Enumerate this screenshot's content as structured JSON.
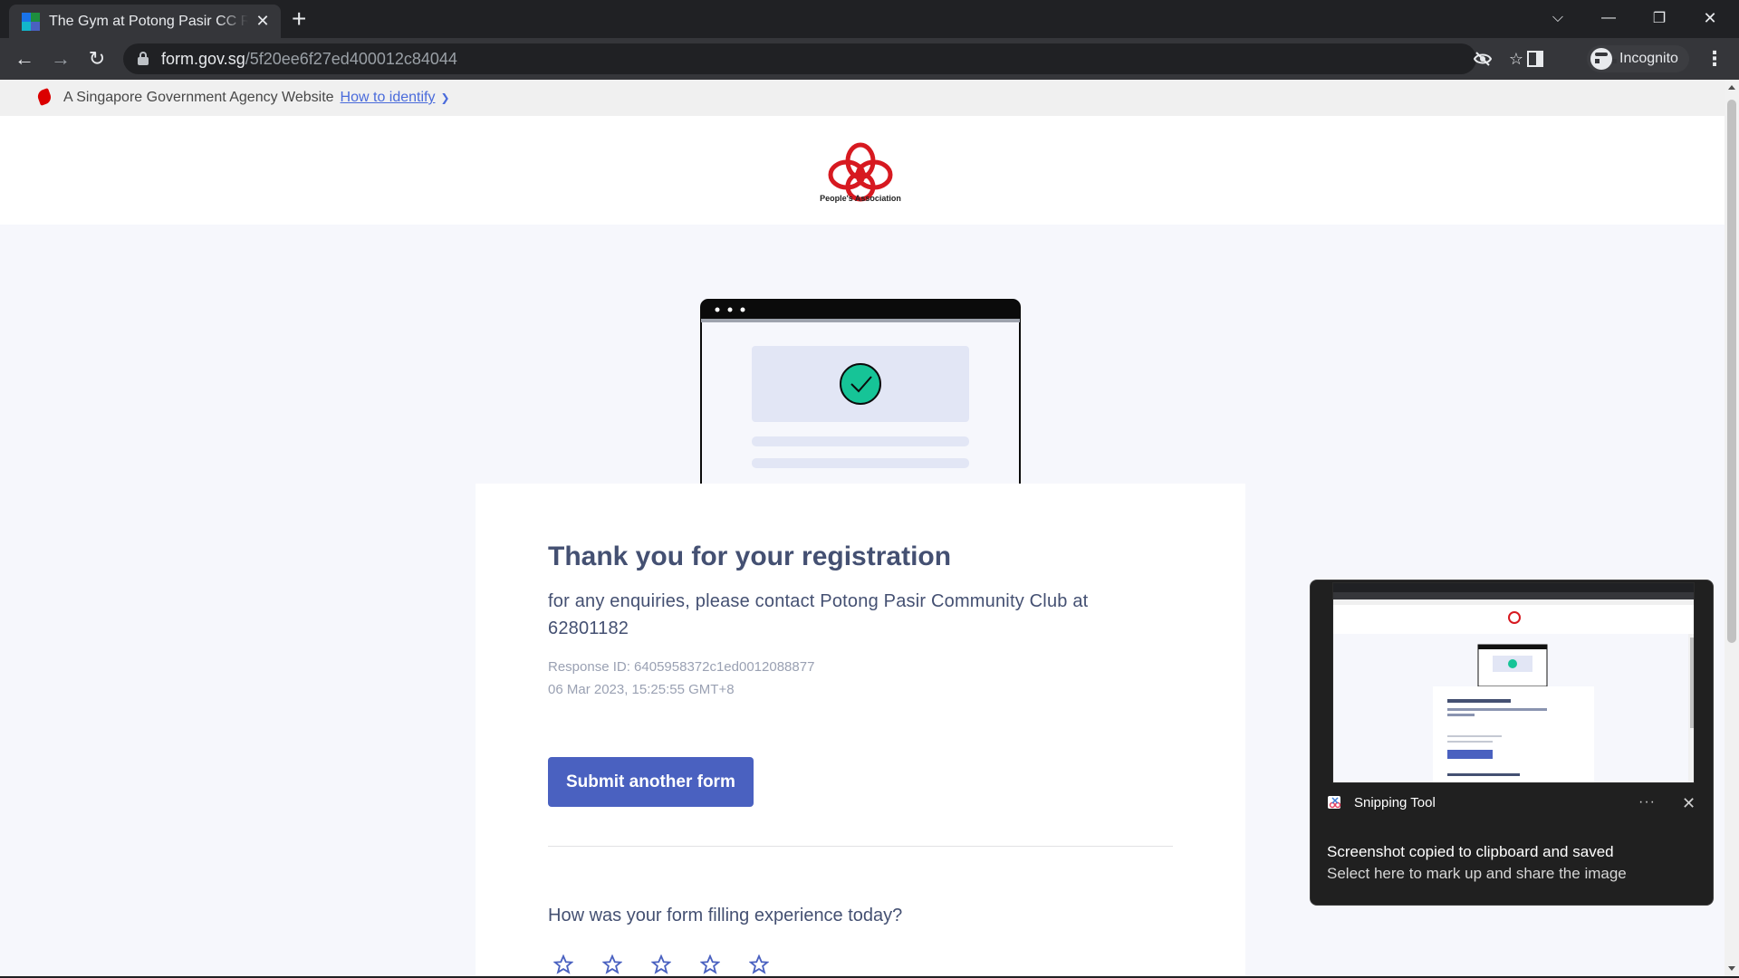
{
  "browser": {
    "tab_title": "The Gym at Potong Pasir CC Registration",
    "url_host": "form.gov.sg",
    "url_path": "/5f20ee6f27ed400012c84044",
    "profile_label": "Incognito",
    "icons": [
      "back-arrow-icon",
      "forward-arrow-icon",
      "reload-icon",
      "lock-icon",
      "eye-off-icon",
      "star-icon",
      "side-panel-icon",
      "incognito-icon",
      "more-vert-icon",
      "chevron-down-icon",
      "minimize-icon",
      "restore-icon",
      "close-icon",
      "new-tab-plus-icon"
    ]
  },
  "masthead": {
    "text": "A Singapore Government Agency Website",
    "link": "How to identify"
  },
  "brand": {
    "caption": "People's Association",
    "logo_color": "#d71920"
  },
  "confirmation": {
    "heading": "Thank you for your registration",
    "enquiry": "for any enquiries,  please contact Potong Pasir Community Club at 62801182",
    "response_id": "Response ID: 6405958372c1ed0012088877",
    "timestamp": "06 Mar 2023, 15:25:55 GMT+8",
    "submit_label": "Submit another form",
    "rating_question": "How was your form filling experience today?",
    "rating_max": 5,
    "accent_color": "#4a61c0",
    "check_color": "#16c497"
  },
  "toast": {
    "app_name": "Snipping Tool",
    "more_label": "···",
    "title": "Screenshot copied to clipboard and saved",
    "subtitle": "Select here to mark up and share the image"
  }
}
